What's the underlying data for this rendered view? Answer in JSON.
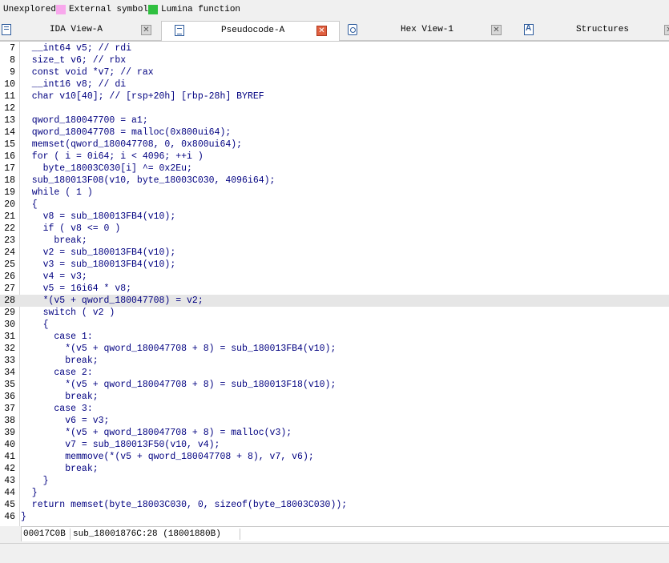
{
  "legend": {
    "items": [
      {
        "label": "Unexplored",
        "color": "#f8a8ec"
      },
      {
        "label": "External symbol",
        "color": "#f8a8ec"
      },
      {
        "label": "Lumina function",
        "color": "#30c040"
      }
    ]
  },
  "tabs": [
    {
      "label": "IDA View-A",
      "icon": "graph-view-icon",
      "active": false
    },
    {
      "label": "Pseudocode-A",
      "icon": "pseudocode-icon",
      "active": true
    },
    {
      "label": "Hex View-1",
      "icon": "hex-view-icon",
      "active": false
    },
    {
      "label": "Structures",
      "icon": "structures-icon",
      "active": false
    }
  ],
  "code": {
    "highlighted_line": 28,
    "lines": [
      {
        "n": "7",
        "text": "  __int64 v5; // rdi"
      },
      {
        "n": "8",
        "text": "  size_t v6; // rbx"
      },
      {
        "n": "9",
        "text": "  const void *v7; // rax"
      },
      {
        "n": "10",
        "text": "  __int16 v8; // di"
      },
      {
        "n": "11",
        "text": "  char v10[40]; // [rsp+20h] [rbp-28h] BYREF"
      },
      {
        "n": "12",
        "text": ""
      },
      {
        "n": "13",
        "text": "  qword_180047700 = a1;"
      },
      {
        "n": "14",
        "text": "  qword_180047708 = malloc(0x800ui64);"
      },
      {
        "n": "15",
        "text": "  memset(qword_180047708, 0, 0x800ui64);"
      },
      {
        "n": "16",
        "text": "  for ( i = 0i64; i < 4096; ++i )"
      },
      {
        "n": "17",
        "text": "    byte_18003C030[i] ^= 0x2Eu;"
      },
      {
        "n": "18",
        "text": "  sub_180013F08(v10, byte_18003C030, 4096i64);"
      },
      {
        "n": "19",
        "text": "  while ( 1 )"
      },
      {
        "n": "20",
        "text": "  {"
      },
      {
        "n": "21",
        "text": "    v8 = sub_180013FB4(v10);"
      },
      {
        "n": "22",
        "text": "    if ( v8 <= 0 )"
      },
      {
        "n": "23",
        "text": "      break;"
      },
      {
        "n": "24",
        "text": "    v2 = sub_180013FB4(v10);"
      },
      {
        "n": "25",
        "text": "    v3 = sub_180013FB4(v10);"
      },
      {
        "n": "26",
        "text": "    v4 = v3;"
      },
      {
        "n": "27",
        "text": "    v5 = 16i64 * v8;"
      },
      {
        "n": "28",
        "text": "    *(v5 + qword_180047708) = v2;"
      },
      {
        "n": "29",
        "text": "    switch ( v2 )"
      },
      {
        "n": "30",
        "text": "    {"
      },
      {
        "n": "31",
        "text": "      case 1:"
      },
      {
        "n": "32",
        "text": "        *(v5 + qword_180047708 + 8) = sub_180013FB4(v10);"
      },
      {
        "n": "33",
        "text": "        break;"
      },
      {
        "n": "34",
        "text": "      case 2:"
      },
      {
        "n": "35",
        "text": "        *(v5 + qword_180047708 + 8) = sub_180013F18(v10);"
      },
      {
        "n": "36",
        "text": "        break;"
      },
      {
        "n": "37",
        "text": "      case 3:"
      },
      {
        "n": "38",
        "text": "        v6 = v3;"
      },
      {
        "n": "39",
        "text": "        *(v5 + qword_180047708 + 8) = malloc(v3);"
      },
      {
        "n": "40",
        "text": "        v7 = sub_180013F50(v10, v4);"
      },
      {
        "n": "41",
        "text": "        memmove(*(v5 + qword_180047708 + 8), v7, v6);"
      },
      {
        "n": "42",
        "text": "        break;"
      },
      {
        "n": "43",
        "text": "    }"
      },
      {
        "n": "44",
        "text": "  }"
      },
      {
        "n": "45",
        "text": "  return memset(byte_18003C030, 0, sizeof(byte_18003C030));"
      },
      {
        "n": "46",
        "text": "}"
      }
    ]
  },
  "status": {
    "offset": "00017C0B",
    "location": "sub_18001876C:28 (18001880B)"
  }
}
